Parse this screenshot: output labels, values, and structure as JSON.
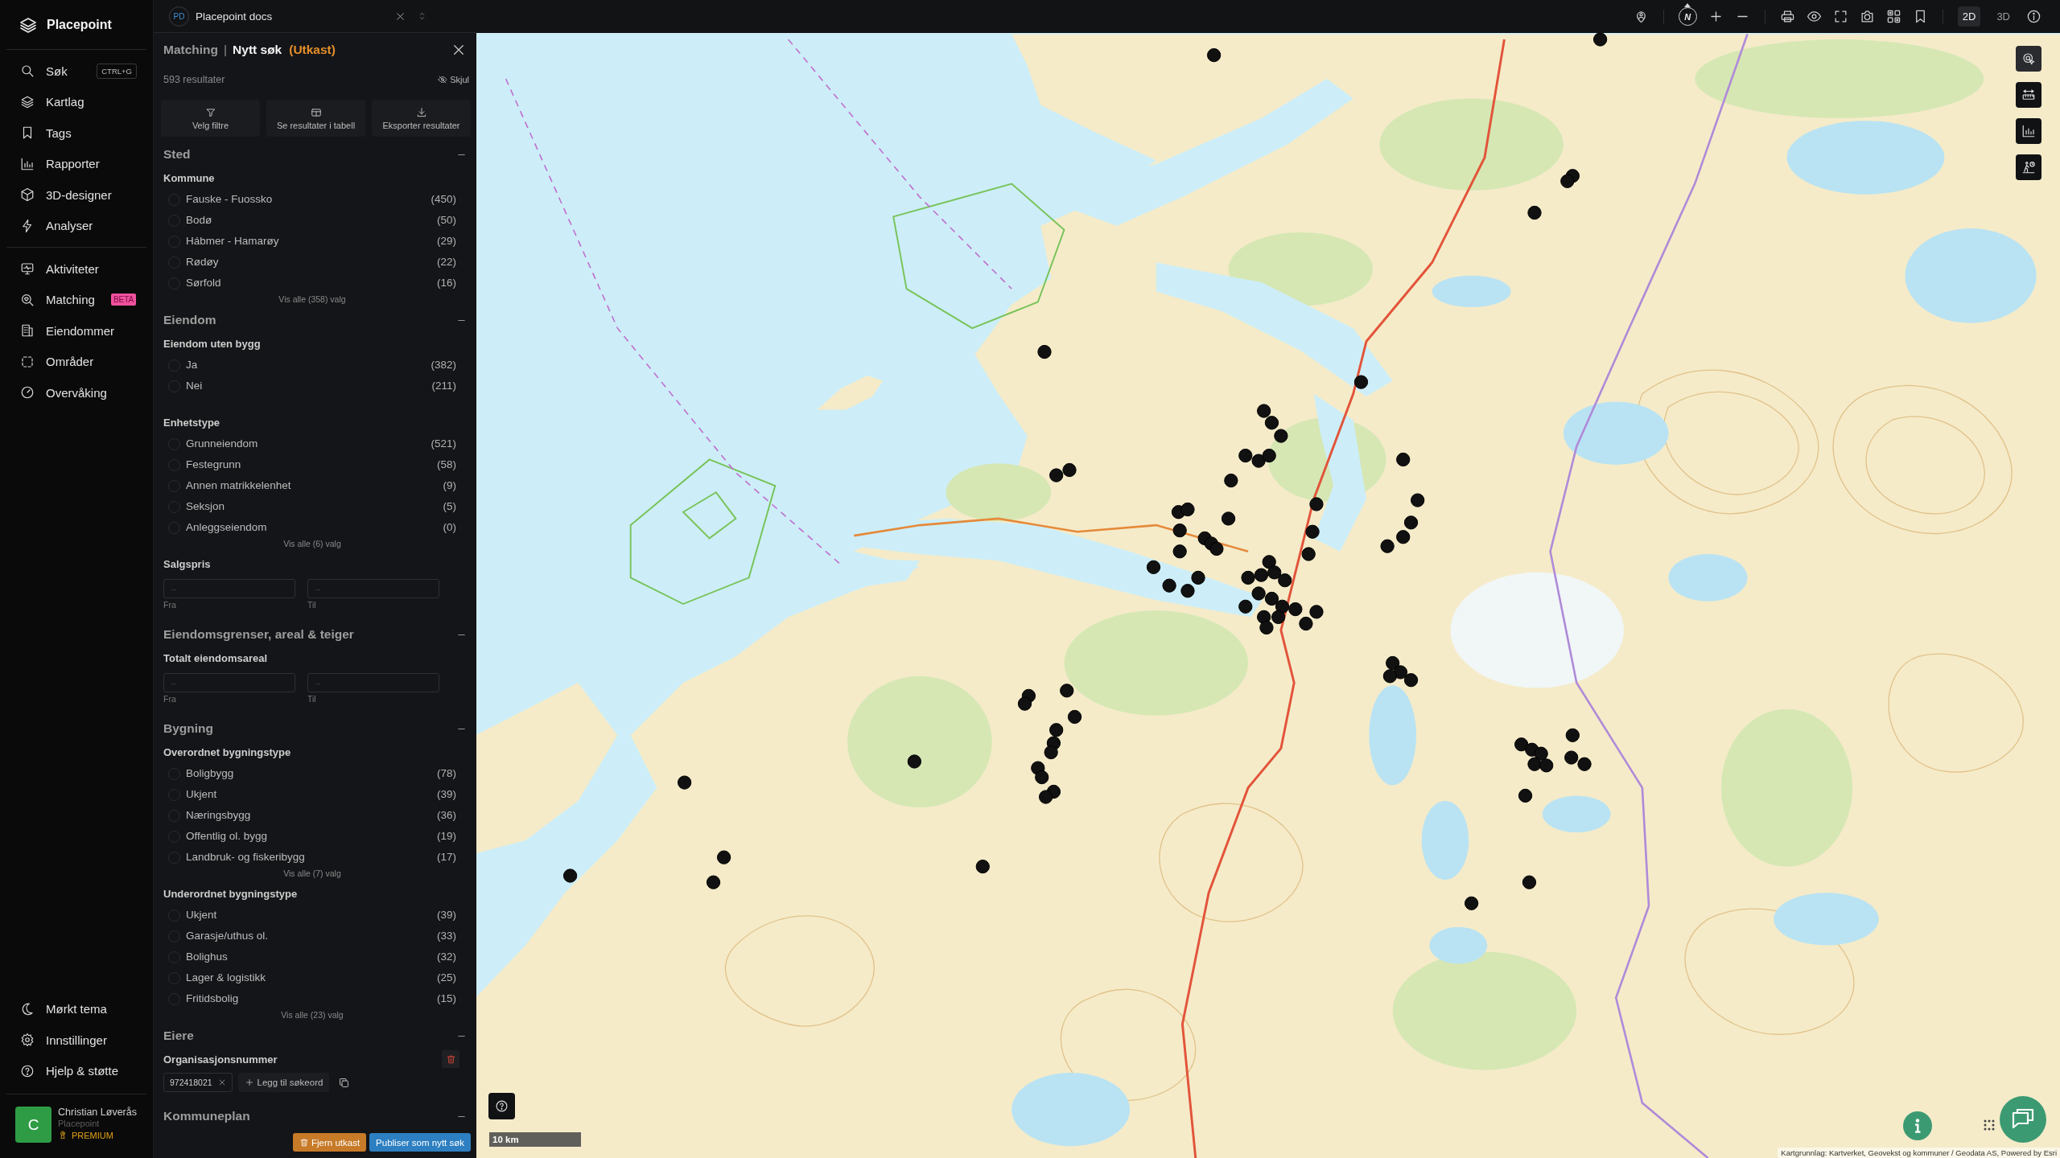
{
  "workspace": {
    "initials": "PD",
    "name": "Placepoint docs"
  },
  "sidebar": {
    "logo": "Placepoint",
    "nav": [
      {
        "label": "Søk",
        "shortcut": "CTRL+G"
      },
      {
        "label": "Kartlag"
      },
      {
        "label": "Tags"
      },
      {
        "label": "Rapporter"
      },
      {
        "label": "3D-designer"
      },
      {
        "label": "Analyser"
      }
    ],
    "tools": [
      {
        "label": "Aktiviteter"
      },
      {
        "label": "Matching",
        "badge": "BETA"
      },
      {
        "label": "Eiendommer"
      },
      {
        "label": "Områder"
      },
      {
        "label": "Overvåking"
      }
    ],
    "footer_nav": [
      {
        "label": "Mørkt tema"
      },
      {
        "label": "Innstillinger"
      },
      {
        "label": "Hjelp & støtte"
      }
    ],
    "user": {
      "initial": "C",
      "name": "Christian Løverås",
      "organization": "Placepoint",
      "plan": "PREMIUM"
    }
  },
  "panel": {
    "breadcrumb": "Matching",
    "separator": "|",
    "title": "Nytt søk",
    "status": "(Utkast)",
    "results": "593 resultater",
    "hide": "Skjul",
    "actions": [
      "Velg filtre",
      "Se resultater i tabell",
      "Eksporter resultater"
    ],
    "sections": [
      {
        "title": "Sted",
        "expanded": true,
        "groups": [
          {
            "kind": "options",
            "title": "Kommune",
            "options": [
              {
                "label": "Fauske - Fuossko",
                "count": "(450)",
                "checked": false
              },
              {
                "label": "Bodø",
                "count": "(50)",
                "checked": false
              },
              {
                "label": "Hábmer - Hamarøy",
                "count": "(29)",
                "checked": false
              },
              {
                "label": "Rødøy",
                "count": "(22)",
                "checked": false
              },
              {
                "label": "Sørfold",
                "count": "(16)",
                "checked": false
              }
            ],
            "more": "Vis alle (358) valg"
          }
        ]
      },
      {
        "title": "Eiendom",
        "expanded": true,
        "groups": [
          {
            "kind": "options",
            "title": "Eiendom uten bygg",
            "options": [
              {
                "label": "Ja",
                "count": "(382)",
                "checked": false
              },
              {
                "label": "Nei",
                "count": "(211)",
                "checked": false
              }
            ]
          },
          {
            "kind": "options",
            "title": "Enhetstype",
            "options": [
              {
                "label": "Grunneiendom",
                "count": "(521)",
                "checked": false
              },
              {
                "label": "Festegrunn",
                "count": "(58)",
                "checked": false
              },
              {
                "label": "Annen matrikkelenhet",
                "count": "(9)",
                "checked": false
              },
              {
                "label": "Seksjon",
                "count": "(5)",
                "checked": false
              },
              {
                "label": "Anleggseiendom",
                "count": "(0)",
                "checked": false
              }
            ],
            "more": "Vis alle (6) valg"
          },
          {
            "kind": "range",
            "title": "Salgspris",
            "fields": [
              {
                "label": "Fra",
                "placeholder": "–"
              },
              {
                "label": "Til",
                "placeholder": "–"
              }
            ]
          }
        ]
      },
      {
        "title": "Eiendomsgrenser, areal & teiger",
        "expanded": true,
        "groups": [
          {
            "kind": "range",
            "title": "Totalt eiendomsareal",
            "fields": [
              {
                "label": "Fra",
                "placeholder": "–"
              },
              {
                "label": "Til",
                "placeholder": "–"
              }
            ]
          }
        ]
      },
      {
        "title": "Bygning",
        "expanded": true,
        "groups": [
          {
            "kind": "options",
            "title": "Overordnet bygningstype",
            "options": [
              {
                "label": "Boligbygg",
                "count": "(78)",
                "checked": false
              },
              {
                "label": "Ukjent",
                "count": "(39)",
                "checked": false
              },
              {
                "label": "Næringsbygg",
                "count": "(36)",
                "checked": false
              },
              {
                "label": "Offentlig ol. bygg",
                "count": "(19)",
                "checked": false
              },
              {
                "label": "Landbruk- og fiskeribygg",
                "count": "(17)",
                "checked": false
              }
            ],
            "more": "Vis alle (7) valg"
          },
          {
            "kind": "options",
            "title": "Underordnet bygningstype",
            "options": [
              {
                "label": "Ukjent",
                "count": "(39)",
                "checked": false
              },
              {
                "label": "Garasje/uthus ol.",
                "count": "(33)",
                "checked": false
              },
              {
                "label": "Bolighus",
                "count": "(32)",
                "checked": false
              },
              {
                "label": "Lager & logistikk",
                "count": "(25)",
                "checked": false
              },
              {
                "label": "Fritidsbolig",
                "count": "(15)",
                "checked": false
              }
            ],
            "more": "Vis alle (23) valg"
          }
        ]
      },
      {
        "title": "Eiere",
        "expanded": true,
        "groups": [
          {
            "kind": "tags",
            "title": "Organisasjonsnummer",
            "tags": [
              "972418021"
            ],
            "add": "Legg til søkeord"
          }
        ]
      },
      {
        "title": "Kommuneplan",
        "expanded": true
      }
    ],
    "footer_buttons": [
      {
        "label": "Fjern utkast",
        "kind": "danger"
      },
      {
        "label": "Publiser som nytt søk",
        "kind": "primary"
      }
    ]
  },
  "map": {
    "compass": "N",
    "view_modes": [
      {
        "label": "2D",
        "selected": true
      },
      {
        "label": "3D",
        "selected": false
      }
    ],
    "scale": "10 km",
    "attribution": "Kartgrunnlag: Kartverket, Geovekst og kommuner / Geodata AS, Powered by Esri"
  }
}
